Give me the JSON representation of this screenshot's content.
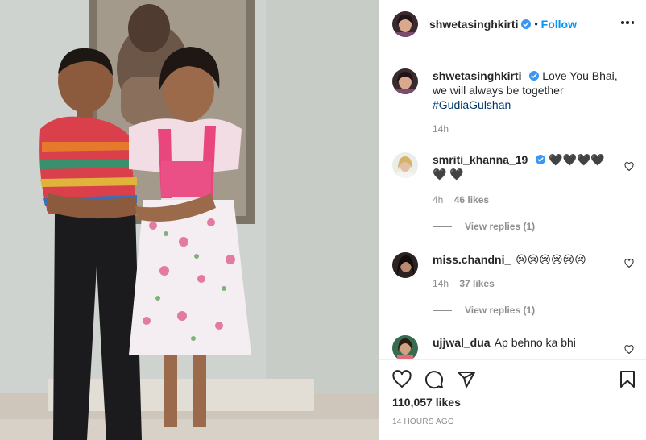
{
  "post": {
    "username": "shwetasinghkirti",
    "follow_label": "Follow",
    "dot": "•",
    "caption": {
      "text": "Love You Bhai, we will always be together",
      "hashtag": "#GudiaGulshan",
      "time": "14h"
    },
    "likes": "110,057 likes",
    "time_ago": "14 HOURS AGO"
  },
  "comments": [
    {
      "username": "smriti_khanna_19",
      "text": "🖤🖤🖤🖤🖤 🖤",
      "time": "4h",
      "likes": "46 likes",
      "view_replies": "View replies (1)"
    },
    {
      "username": "miss.chandni_",
      "text": "😢😢😢😢😢😢",
      "time": "14h",
      "likes": "37 likes",
      "view_replies": "View replies (1)"
    },
    {
      "username": "ujjwal_dua",
      "text": "Ap behno ka bhi",
      "time": "",
      "likes": "",
      "view_replies": ""
    }
  ],
  "colors": {
    "accent": "#0095f6",
    "hashtag": "#00376b",
    "muted": "#8e8e8e",
    "text": "#262626"
  },
  "icons": [
    "verified-badge-icon",
    "more-options-icon",
    "heart-icon",
    "comment-icon",
    "share-icon",
    "bookmark-icon"
  ]
}
